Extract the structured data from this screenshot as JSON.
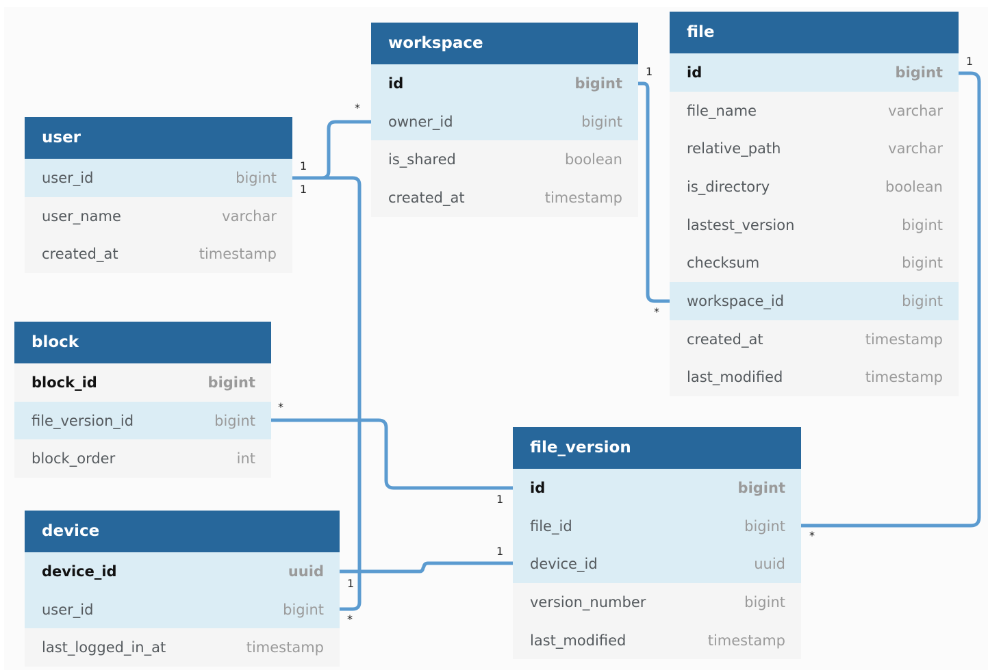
{
  "diagram": {
    "accent_color": "#27679b",
    "highlight_row_color": "#dbedf5",
    "connector_color": "#5b9bd0",
    "tables": {
      "user": {
        "title": "user",
        "columns": [
          {
            "name": "user_id",
            "type": "bigint"
          },
          {
            "name": "user_name",
            "type": "varchar"
          },
          {
            "name": "created_at",
            "type": "timestamp"
          }
        ]
      },
      "workspace": {
        "title": "workspace",
        "columns": [
          {
            "name": "id",
            "type": "bigint",
            "primary_key": true
          },
          {
            "name": "owner_id",
            "type": "bigint"
          },
          {
            "name": "is_shared",
            "type": "boolean"
          },
          {
            "name": "created_at",
            "type": "timestamp"
          }
        ]
      },
      "file": {
        "title": "file",
        "columns": [
          {
            "name": "id",
            "type": "bigint",
            "primary_key": true
          },
          {
            "name": "file_name",
            "type": "varchar"
          },
          {
            "name": "relative_path",
            "type": "varchar"
          },
          {
            "name": "is_directory",
            "type": "boolean"
          },
          {
            "name": "lastest_version",
            "type": "bigint"
          },
          {
            "name": "checksum",
            "type": "bigint"
          },
          {
            "name": "workspace_id",
            "type": "bigint"
          },
          {
            "name": "created_at",
            "type": "timestamp"
          },
          {
            "name": "last_modified",
            "type": "timestamp"
          }
        ]
      },
      "block": {
        "title": "block",
        "columns": [
          {
            "name": "block_id",
            "type": "bigint",
            "primary_key": true
          },
          {
            "name": "file_version_id",
            "type": "bigint"
          },
          {
            "name": "block_order",
            "type": "int"
          }
        ]
      },
      "device": {
        "title": "device",
        "columns": [
          {
            "name": "device_id",
            "type": "uuid",
            "primary_key": true
          },
          {
            "name": "user_id",
            "type": "bigint"
          },
          {
            "name": "last_logged_in_at",
            "type": "timestamp"
          }
        ]
      },
      "file_version": {
        "title": "file_version",
        "columns": [
          {
            "name": "id",
            "type": "bigint",
            "primary_key": true
          },
          {
            "name": "file_id",
            "type": "bigint"
          },
          {
            "name": "device_id",
            "type": "uuid"
          },
          {
            "name": "version_number",
            "type": "bigint"
          },
          {
            "name": "last_modified",
            "type": "timestamp"
          }
        ]
      }
    },
    "relationships": [
      {
        "from": "user.user_id",
        "from_card": "1",
        "to": "workspace.owner_id",
        "to_card": "*"
      },
      {
        "from": "user.user_id",
        "from_card": "1",
        "to": "device.user_id",
        "to_card": "*"
      },
      {
        "from": "workspace.id",
        "from_card": "1",
        "to": "file.workspace_id",
        "to_card": "*"
      },
      {
        "from": "file.id",
        "from_card": "1",
        "to": "file_version.file_id",
        "to_card": "*"
      },
      {
        "from": "file_version.id",
        "from_card": "1",
        "to": "block.file_version_id",
        "to_card": "*"
      },
      {
        "from": "device.device_id",
        "from_card": "1",
        "to": "file_version.device_id",
        "to_card": "1"
      }
    ]
  }
}
